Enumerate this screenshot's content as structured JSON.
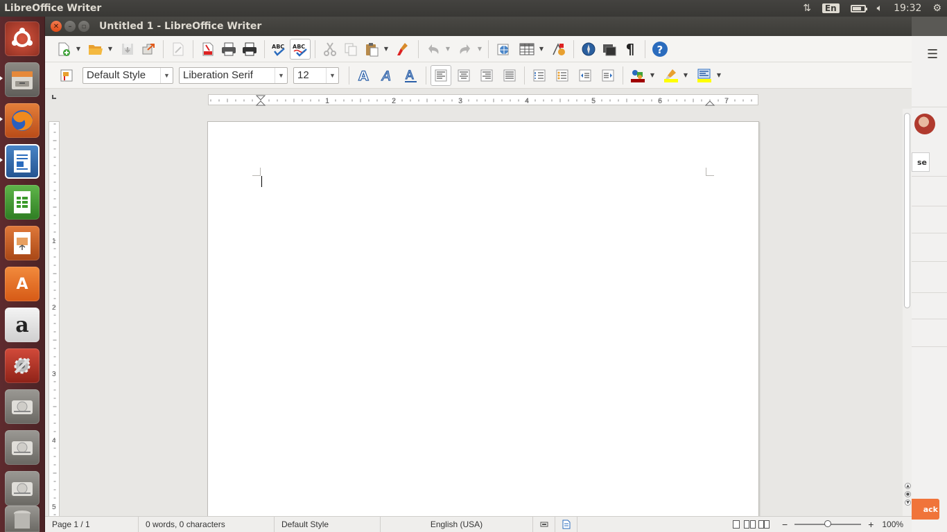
{
  "top_panel": {
    "app_title": "LibreOffice Writer",
    "keyboard_layout": "En",
    "clock": "19:32"
  },
  "launcher": {
    "items": [
      {
        "name": "ubuntu-dash",
        "glyph": "◉"
      },
      {
        "name": "files"
      },
      {
        "name": "firefox"
      },
      {
        "name": "libreoffice-writer"
      },
      {
        "name": "libreoffice-calc"
      },
      {
        "name": "libreoffice-impress"
      },
      {
        "name": "ubuntu-software",
        "glyph": "A"
      },
      {
        "name": "amazon",
        "glyph": "a"
      },
      {
        "name": "system-settings"
      },
      {
        "name": "drive-1"
      },
      {
        "name": "drive-2"
      },
      {
        "name": "drive-3"
      },
      {
        "name": "trash"
      }
    ]
  },
  "background_window": {
    "close_label": "se",
    "back_label": "ack"
  },
  "window": {
    "title": "Untitled 1 - LibreOffice Writer"
  },
  "formatting": {
    "paragraph_style": "Default Style",
    "font_name": "Liberation Serif",
    "font_size": "12"
  },
  "ruler": {
    "horizontal_numbers": [
      "1",
      "2",
      "3",
      "4",
      "5",
      "6",
      "7"
    ],
    "vertical_numbers": [
      "1",
      "2",
      "3",
      "4",
      "5"
    ]
  },
  "statusbar": {
    "page": "Page 1 / 1",
    "word_count": "0 words, 0 characters",
    "page_style": "Default Style",
    "language": "English (USA)",
    "zoom": "100%",
    "zoom_level": 0.5
  },
  "colors": {
    "launcher_bg": "#5e2b2e",
    "close_button": "#df4a16",
    "accent_blue": "#2a6bbd",
    "font_color": "#c00000",
    "highlight": "#ffff00"
  }
}
